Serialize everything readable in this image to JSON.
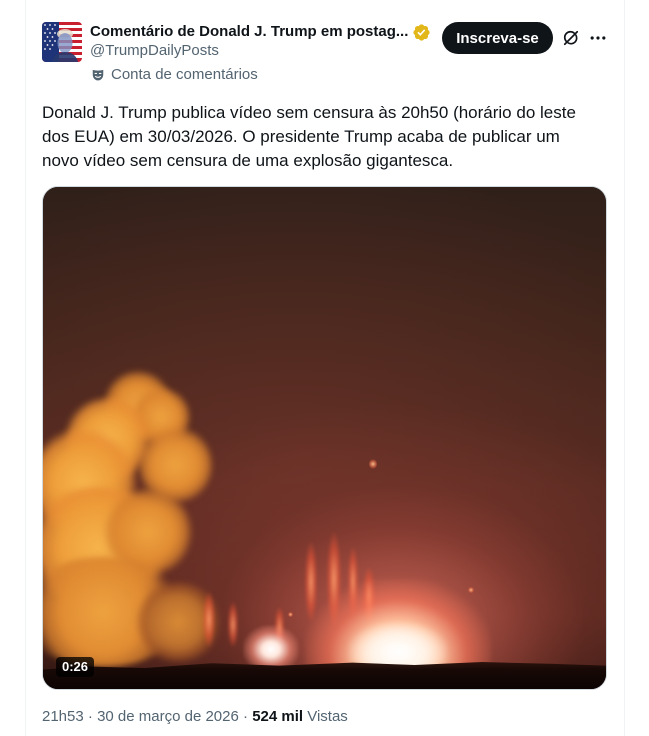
{
  "post": {
    "author": {
      "display_name": "Comentário de Donald J. Trump em postag...",
      "handle": "@TrumpDailyPosts",
      "avatar_icon": "american-flag-portrait-avatar",
      "verified_badge_icon": "gold-verified-badge-icon",
      "account_label": "Conta de comentários",
      "account_label_icon": "commentary-mask-icon"
    },
    "actions": {
      "subscribe_label": "Inscreva-se",
      "grok_icon": "grok-icon",
      "more_icon": "more-options-icon"
    },
    "text_lines": [
      "Donald J. Trump publica vídeo sem censura às 20h50 (horário do leste",
      "dos EUA) em 30/03/2026. O presidente Trump acaba de publicar um",
      "novo vídeo sem censura de uma explosão gigantesca."
    ],
    "media": {
      "video_duration": "0:26"
    },
    "meta": {
      "time": "21h53",
      "separator": "·",
      "date": "30 de março de 2026",
      "views_count": "524 mil",
      "views_label": "Vistas"
    }
  },
  "colors": {
    "text_primary": "#0f1419",
    "text_secondary": "#536471",
    "subscribe_button_bg": "#0f1419",
    "subscribe_button_text": "#ffffff",
    "border": "#eff3f4",
    "media_border": "#cfd9de",
    "verified_badge": "#e2b719"
  }
}
